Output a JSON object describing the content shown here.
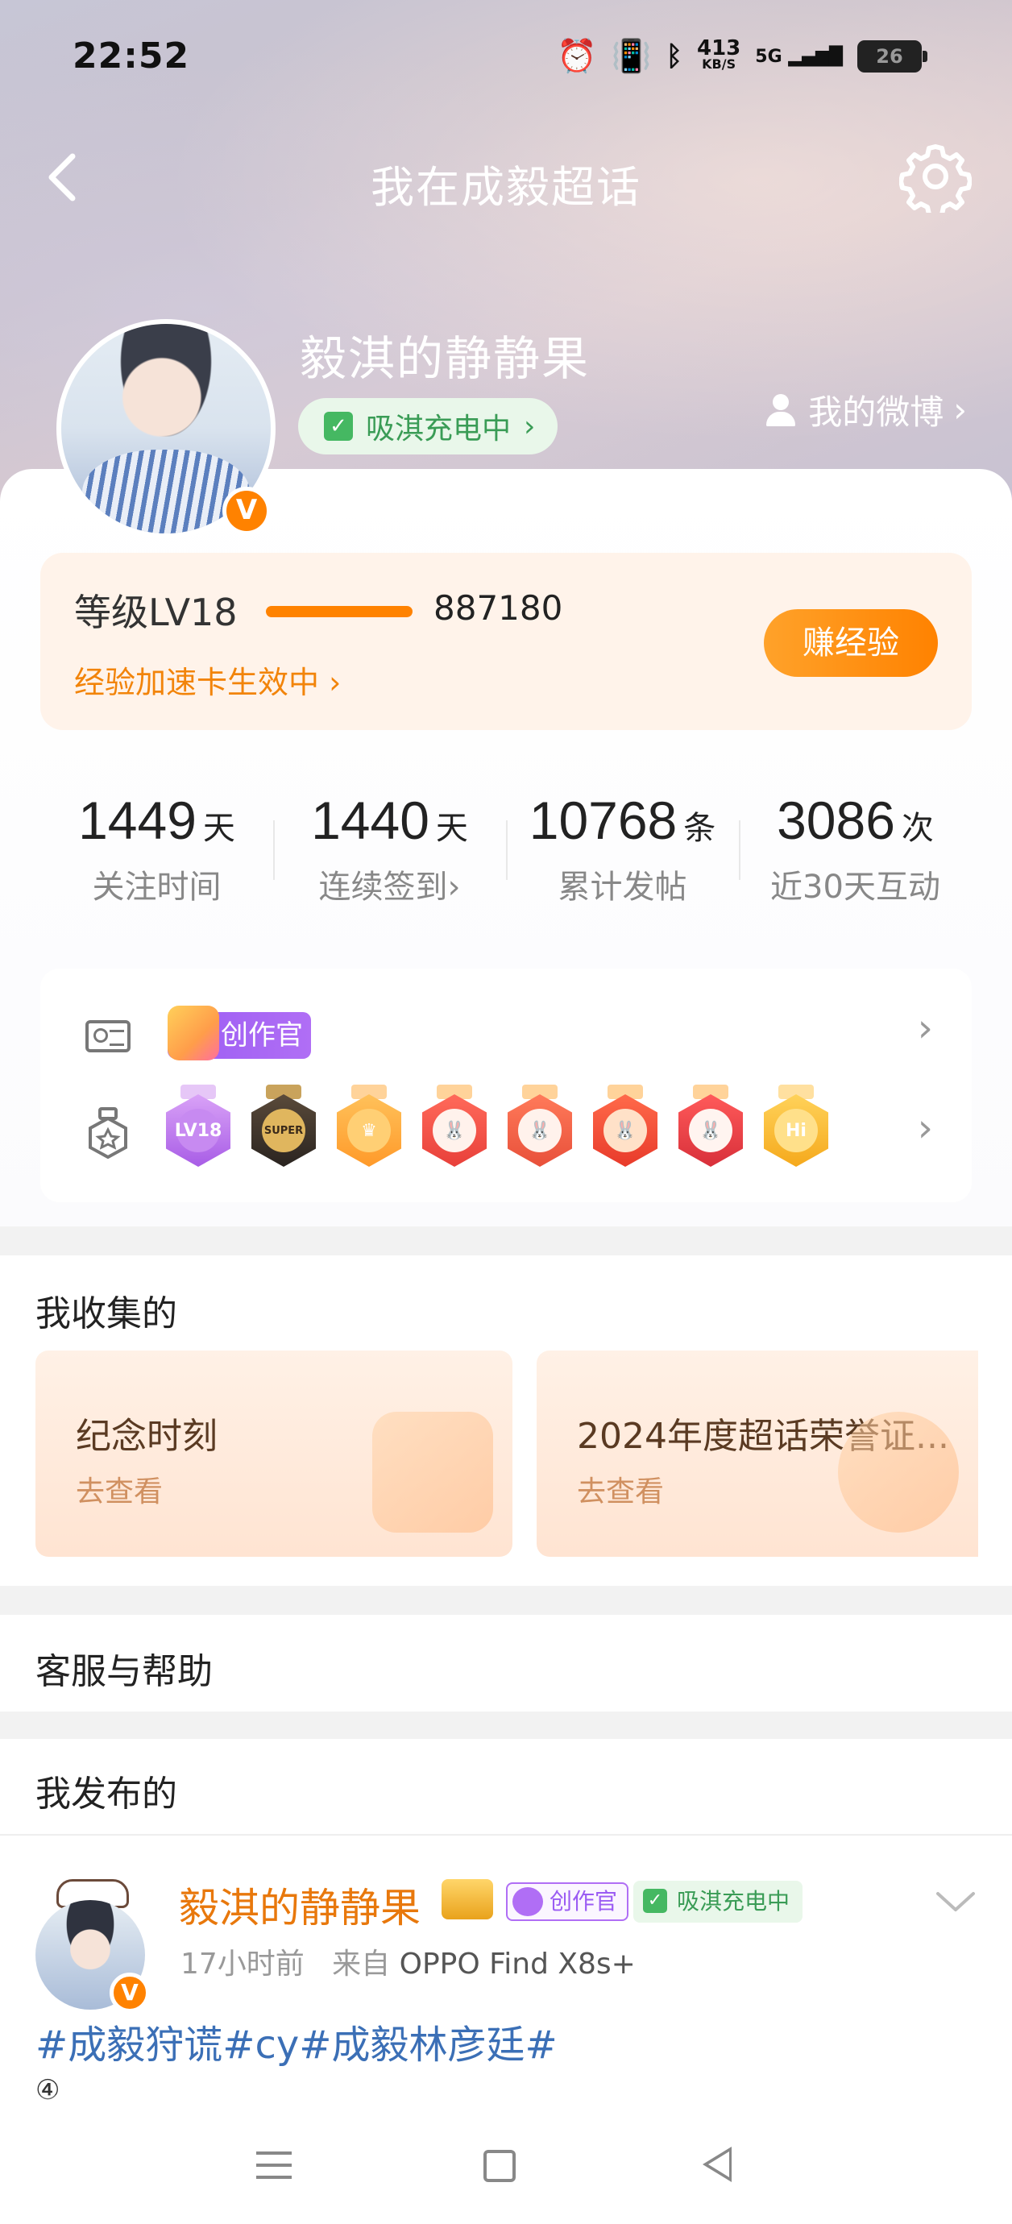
{
  "status_bar": {
    "time": "22:52",
    "net_speed_value": "413",
    "net_speed_unit": "KB/S",
    "network": "5G",
    "battery": "26"
  },
  "nav": {
    "title": "我在成毅超话"
  },
  "profile": {
    "username": "毅淇的静静果",
    "charge_label": "吸淇充电中",
    "my_weibo_label": "我的微博",
    "verified_badge": "V"
  },
  "level": {
    "label": "等级LV18",
    "exp": "887180",
    "speed_card": "经验加速卡生效中",
    "earn_button": "赚经验"
  },
  "stats": [
    {
      "num": "1449",
      "unit": "天",
      "label": "关注时间"
    },
    {
      "num": "1440",
      "unit": "天",
      "label": "连续签到"
    },
    {
      "num": "10768",
      "unit": "条",
      "label": "累计发帖"
    },
    {
      "num": "3086",
      "unit": "次",
      "label": "近30天互动"
    }
  ],
  "badges": {
    "creator_label": "创作官",
    "medal_icons": [
      "lv18-medal",
      "super-medal",
      "crown-medal",
      "rabbit-medal-1",
      "rabbit-medal-2",
      "rabbit-medal-3",
      "rabbit-medal-4",
      "hi-medal"
    ],
    "medal_texts": {
      "lv18": "LV18",
      "super": "SUPER",
      "hi": "Hi"
    }
  },
  "collected": {
    "title": "我收集的",
    "cards": [
      {
        "title": "纪念时刻",
        "sub": "去查看"
      },
      {
        "title": "2024年度超话荣誉证...",
        "sub": "去查看"
      }
    ]
  },
  "help": {
    "title": "客服与帮助"
  },
  "posted": {
    "title": "我发布的",
    "author": "毅淇的静静果",
    "creator_tag": "创作官",
    "charge_tag": "吸淇充电中",
    "time": "17小时前",
    "from_label": "来自",
    "source": "OPPO Find X8s+",
    "text": "#成毅狩谎#cy#成毅林彦廷#",
    "more": "④"
  },
  "colors": {
    "accent_orange": "#ff8200",
    "charge_green": "#45b862",
    "creator_purple": "#9b5cf3",
    "topic_blue": "#3b6fb6"
  }
}
